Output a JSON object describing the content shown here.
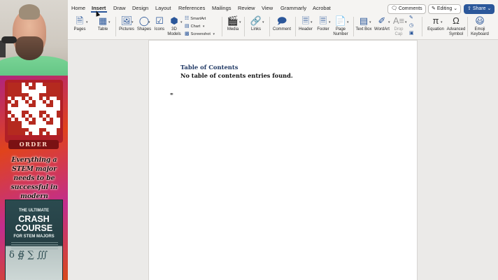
{
  "sidebar": {
    "qr_label": "ORDER",
    "promo_text": "Everything a STEM major needs to be successful in modern education",
    "book": {
      "line1": "THE ULTIMATE",
      "line2": "CRASH COURSE",
      "line3": "FOR STEM MAJORS",
      "glyphs": "δ ∯ ∑ ∭"
    }
  },
  "ribbon": {
    "tabs": [
      "Home",
      "Insert",
      "Draw",
      "Design",
      "Layout",
      "References",
      "Mailings",
      "Review",
      "View",
      "Grammarly",
      "Acrobat"
    ],
    "active_tab": "Insert",
    "comments_label": "Comments",
    "editing_label": "Editing",
    "share_label": "Share",
    "buttons": {
      "pages": "Pages",
      "table": "Table",
      "pictures": "Pictures",
      "shapes": "Shapes",
      "icons": "Icons",
      "models_3d": "3D Models",
      "smartart": "SmartArt",
      "chart": "Chart",
      "screenshot": "Screenshot",
      "media": "Media",
      "links": "Links",
      "comment": "Comment",
      "header": "Header",
      "footer": "Footer",
      "page_number": "Page Number",
      "text_box": "Text Box",
      "wordart": "WordArt",
      "drop_cap": "Drop Cap",
      "equation": "Equation",
      "advanced_symbol": "Advanced Symbol",
      "emoji_keyboard": "Emoji Keyboard"
    }
  },
  "document": {
    "toc_title": "Table of Contents",
    "toc_empty_message": "No table of contents entries found."
  },
  "colors": {
    "accent": "#2b579a",
    "toc_title": "#1f3864"
  }
}
